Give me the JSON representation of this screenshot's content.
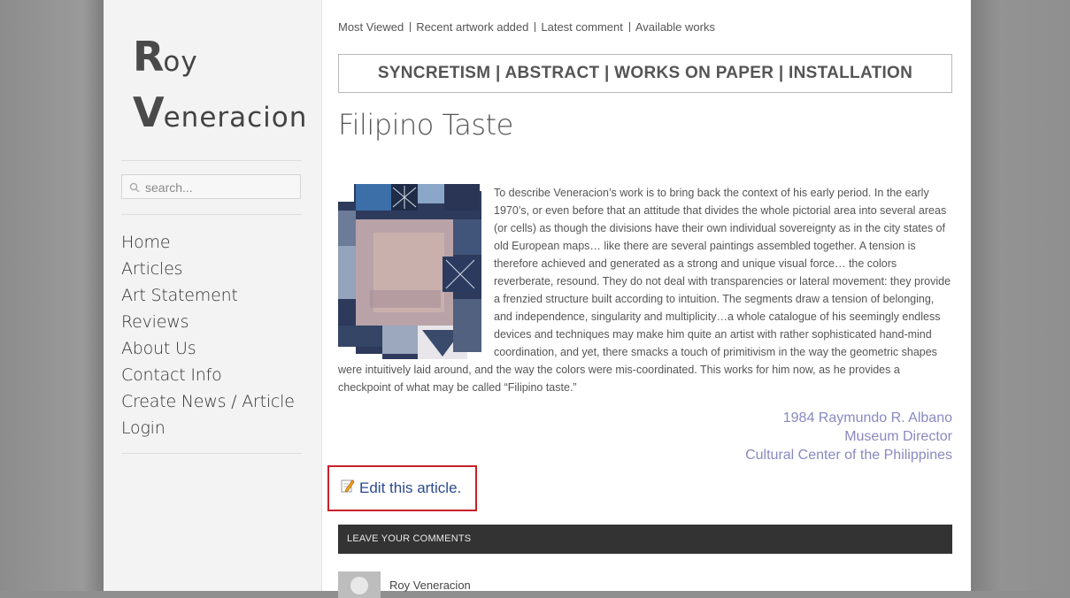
{
  "logo": {
    "first_initial": "R",
    "first_rest": "oy",
    "last_initial": "V",
    "last_rest": "eneracion"
  },
  "search": {
    "placeholder": "search..."
  },
  "nav": {
    "items": [
      "Home",
      "Articles",
      "Art Statement",
      "Reviews",
      "About Us",
      "Contact Info",
      "Create News / Article",
      "Login"
    ]
  },
  "toplinks": [
    "Most Viewed",
    "Recent artwork added",
    "Latest comment",
    "Available works"
  ],
  "banner": "SYNCRETISM | ABSTRACT | WORKS ON PAPER | INSTALLATION",
  "article": {
    "title": "Filipino Taste",
    "body": "To describe Veneracion’s work is to bring back the context of his early period. In the early 1970’s, or even before that an attitude that divides the whole pictorial area into several areas (or cells) as though the divisions have their own individual sovereignty as in the city states of old European maps… like there are several paintings assembled together. A tension is therefore achieved and generated as a strong and unique visual force… the colors reverberate, resound. They do not deal with transparencies or lateral movement: they provide a frenzied structure built according to intuition. The segments draw a tension of belonging, and independence, singularity and multiplicity…a whole catalogue of his seemingly endless devices and techniques may make him quite an artist with rather sophisticated hand-mind coordination, and yet, there smacks a touch of primitivism in the way the geometric shapes were intuitively laid around, and the way the colors were mis-coordinated. This works for him now, as he provides a checkpoint of what may be called “Filipino taste.”",
    "signature": [
      "1984 Raymundo R. Albano",
      "Museum Director",
      "Cultural Center of the Philippines"
    ],
    "edit_label": "Edit this article."
  },
  "comments": {
    "header": "LEAVE YOUR COMMENTS",
    "first_commenter": "Roy Veneracion"
  },
  "colors": {
    "accent_link": "#8a88c0",
    "edit_link": "#2b4a8f",
    "highlight_border": "#c8202a",
    "comments_bar": "#333333"
  }
}
